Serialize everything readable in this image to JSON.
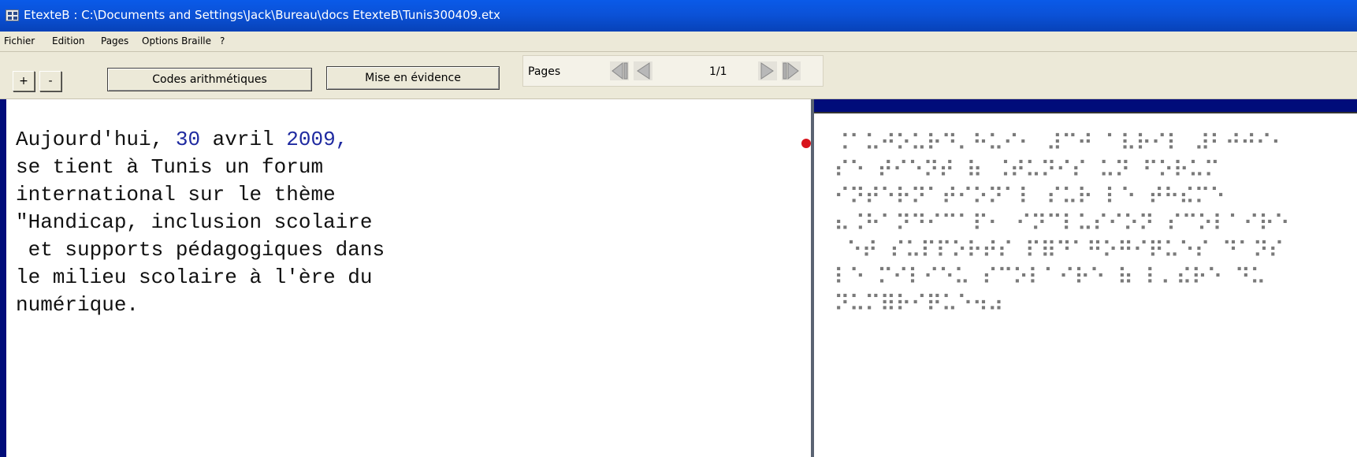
{
  "window": {
    "title": "EtexteB : C:\\Documents and Settings\\Jack\\Bureau\\docs EtexteB\\Tunis300409.etx"
  },
  "menu": {
    "items": [
      "Fichier",
      "Edition",
      "Pages",
      "Options Braille",
      "?"
    ]
  },
  "toolbar": {
    "zoom_in_label": "+",
    "zoom_out_label": "-",
    "codes_label": "Codes arithmétiques",
    "highlight_label": "Mise en évidence",
    "pages_label": "Pages",
    "page_indicator": "1/1"
  },
  "icons": {
    "app": "app-icon",
    "first_page": "first-page-icon",
    "prev_page": "previous-page-icon",
    "next_page": "next-page-icon",
    "last_page": "last-page-icon"
  },
  "colors": {
    "highlight": "#1f2aa0",
    "cursor": "#d8141c",
    "titlebar": "#0b52d8"
  },
  "editor": {
    "lines": [
      "Aujourd'hui, 30 avril 2009,",
      "se tient à Tunis un forum",
      "international sur le thème",
      "\"Handicap, inclusion scolaire",
      " et supports pédagogiques dans",
      "le milieu scolaire à l'ère du",
      "numérique."
    ],
    "highlighted_numbers": [
      "30",
      "2009"
    ]
  },
  "braille": {
    "lines": [
      "⠨⠁⠥⠚⠕⠥⠗⠙⠄⠓⠥⠊⠂ ⠼⠉⠚ ⠁⠧⠗⠊⠇ ⠼⠃⠚⠚⠊⠂",
      "⠎⠑ ⠞⠊⠑⠝⠞ ⠷ ⠨⠞⠥⠝⠊⠎ ⠥⠝ ⠋⠕⠗⠥⠍",
      "⠊⠝⠞⠑⠗⠝⠁⠞⠊⠕⠝⠁⠇ ⠎⠥⠗ ⠇⠑ ⠞⠓⠮⠍⠑",
      "⠦⠨⠓⠁⠝⠙⠊⠉⠁⠏⠂ ⠊⠝⠉⠇⠥⠎⠊⠕⠝ ⠎⠉⠕⠇⠁⠊⠗⠑",
      " ⠑⠞ ⠎⠥⠏⠏⠕⠗⠞⠎ ⠏⠿⠙⠁⠛⠕⠛⠊⠟⠥⠑⠎ ⠙⠁⠝⠎",
      "⠇⠑ ⠍⠊⠇⠊⠑⠥ ⠎⠉⠕⠇⠁⠊⠗⠑ ⠷ ⠇⠄⠮⠗⠑ ⠙⠥",
      "⠝⠥⠍⠿⠗⠊⠟⠥⠑⠲⠴"
    ]
  }
}
